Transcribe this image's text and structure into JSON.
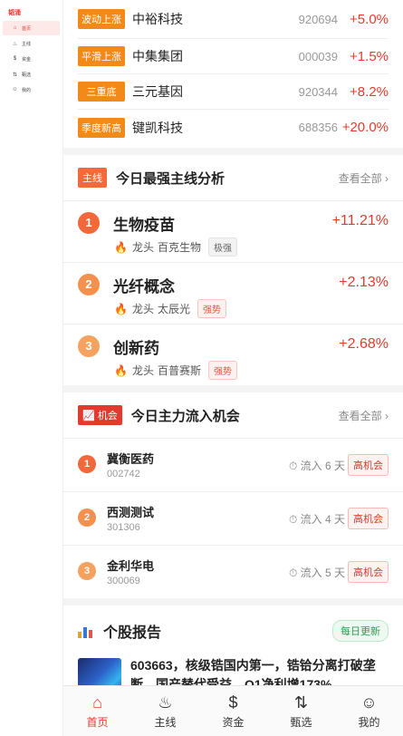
{
  "sidebar": {
    "brand": "韬涌",
    "items": [
      {
        "icon": "home-icon",
        "glyph": "⌂",
        "label": "首页",
        "active": true
      },
      {
        "icon": "flame-icon",
        "glyph": "♨",
        "label": "主线",
        "active": false
      },
      {
        "icon": "dollar-icon",
        "glyph": "$",
        "label": "资金",
        "active": false
      },
      {
        "icon": "filter-icon",
        "glyph": "⇅",
        "label": "甄选",
        "active": false
      },
      {
        "icon": "user-icon",
        "glyph": "☺",
        "label": "我的",
        "active": false
      }
    ]
  },
  "signals": [
    {
      "tag": "波动上涨",
      "name": "中裕科技",
      "code": "920694",
      "pct": "+5.0%"
    },
    {
      "tag": "平滑上涨",
      "name": "中集集团",
      "code": "000039",
      "pct": "+1.5%"
    },
    {
      "tag": "三重底",
      "name": "三元基因",
      "code": "920344",
      "pct": "+8.2%"
    },
    {
      "tag": "季度新高",
      "name": "键凯科技",
      "code": "688356",
      "pct": "+20.0%"
    }
  ],
  "themes_section": {
    "badge": "主线",
    "title": "今日最强主线分析",
    "more": "查看全部 ›",
    "items": [
      {
        "rank": "1",
        "name": "生物疫苗",
        "pct": "+11.21%",
        "lead_label": "龙头",
        "lead": "百克生物",
        "strength": "极强"
      },
      {
        "rank": "2",
        "name": "光纤概念",
        "pct": "+2.13%",
        "lead_label": "龙头",
        "lead": "太辰光",
        "strength": "强势"
      },
      {
        "rank": "3",
        "name": "创新药",
        "pct": "+2.68%",
        "lead_label": "龙头",
        "lead": "百普赛斯",
        "strength": "强势"
      }
    ]
  },
  "opps_section": {
    "badge": "📈 机会",
    "title": "今日主力流入机会",
    "more": "查看全部 ›",
    "items": [
      {
        "rank": "1",
        "name": "冀衡医药",
        "code": "002742",
        "flow": "⏱ 流入 6 天",
        "badge": "高机会"
      },
      {
        "rank": "2",
        "name": "西测测试",
        "code": "301306",
        "flow": "⏱ 流入 4 天",
        "badge": "高机会"
      },
      {
        "rank": "3",
        "name": "金利华电",
        "code": "300069",
        "flow": "⏱ 流入 5 天",
        "badge": "高机会"
      }
    ]
  },
  "report_section": {
    "title": "个股报告",
    "daily": "每日更新",
    "item_text": "603663，核级锆国内第一，锆铪分离打破垄断，国产替代受益，Q1净利增173%"
  },
  "bottom_nav": [
    {
      "icon": "home-icon",
      "glyph": "⌂",
      "label": "首页",
      "active": true
    },
    {
      "icon": "flame-icon",
      "glyph": "♨",
      "label": "主线",
      "active": false
    },
    {
      "icon": "dollar-icon",
      "glyph": "$",
      "label": "资金",
      "active": false
    },
    {
      "icon": "filter-icon",
      "glyph": "⇅",
      "label": "甄选",
      "active": false
    },
    {
      "icon": "user-icon",
      "glyph": "☺",
      "label": "我的",
      "active": false
    }
  ]
}
